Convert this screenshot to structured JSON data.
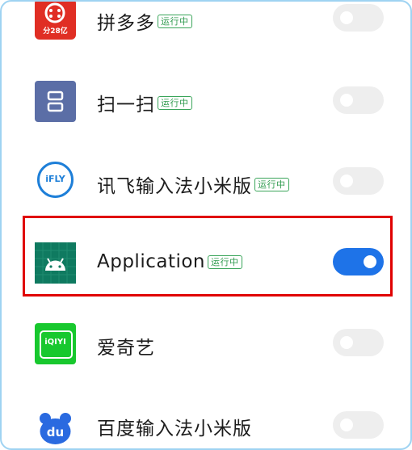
{
  "apps": [
    {
      "name": "拼多多",
      "badge": "运行中",
      "enabled": false,
      "icon": "pinduoduo-icon",
      "icon_caption": "分28亿",
      "color": "#e02e24"
    },
    {
      "name": "扫一扫",
      "badge": "运行中",
      "enabled": false,
      "icon": "scan-icon",
      "color": "#5b6ea6"
    },
    {
      "name": "讯飞输入法小米版",
      "badge": "运行中",
      "enabled": false,
      "icon": "iflytek-icon",
      "icon_caption": "iFLY",
      "color": "#1e7fd8"
    },
    {
      "name": "Application",
      "badge": "运行中",
      "enabled": true,
      "icon": "android-icon",
      "color": "#0f7a60",
      "highlighted": true
    },
    {
      "name": "爱奇艺",
      "badge": "",
      "enabled": false,
      "icon": "iqiyi-icon",
      "icon_caption": "iQIYI",
      "color": "#18c82e"
    },
    {
      "name": "百度输入法小米版",
      "badge": "",
      "enabled": false,
      "icon": "baidu-input-icon",
      "icon_caption": "du",
      "color": "#2a6ae0"
    }
  ],
  "colors": {
    "toggle_on": "#1e73e8",
    "toggle_off": "#eeeeee",
    "badge_green": "#2f9a4e",
    "highlight_red": "#e00000"
  }
}
